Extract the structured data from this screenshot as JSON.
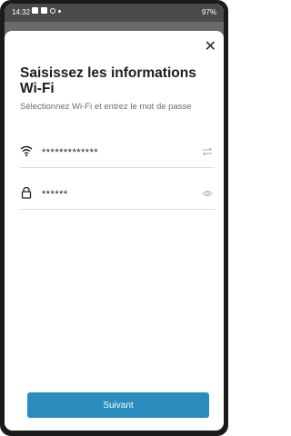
{
  "status_bar": {
    "time": "14:32",
    "right": "97%"
  },
  "dialog": {
    "title": "Saisissez les informations Wi-Fi",
    "subtitle": "Sélectionnez Wi-Fi et entrez le mot de passe",
    "wifi_field": {
      "value": "*************",
      "icon": "wifi-icon",
      "action_icon": "swap-icon"
    },
    "password_field": {
      "value": "******",
      "icon": "lock-icon",
      "action_icon": "eye-icon"
    },
    "submit_label": "Suivant",
    "close_icon": "close-icon"
  },
  "colors": {
    "accent": "#2a8cbd",
    "frame": "#1a1a1a",
    "status_bar": "#4a4a4a",
    "title": "#1d1d1d",
    "subtitle": "#6d6d6d"
  }
}
